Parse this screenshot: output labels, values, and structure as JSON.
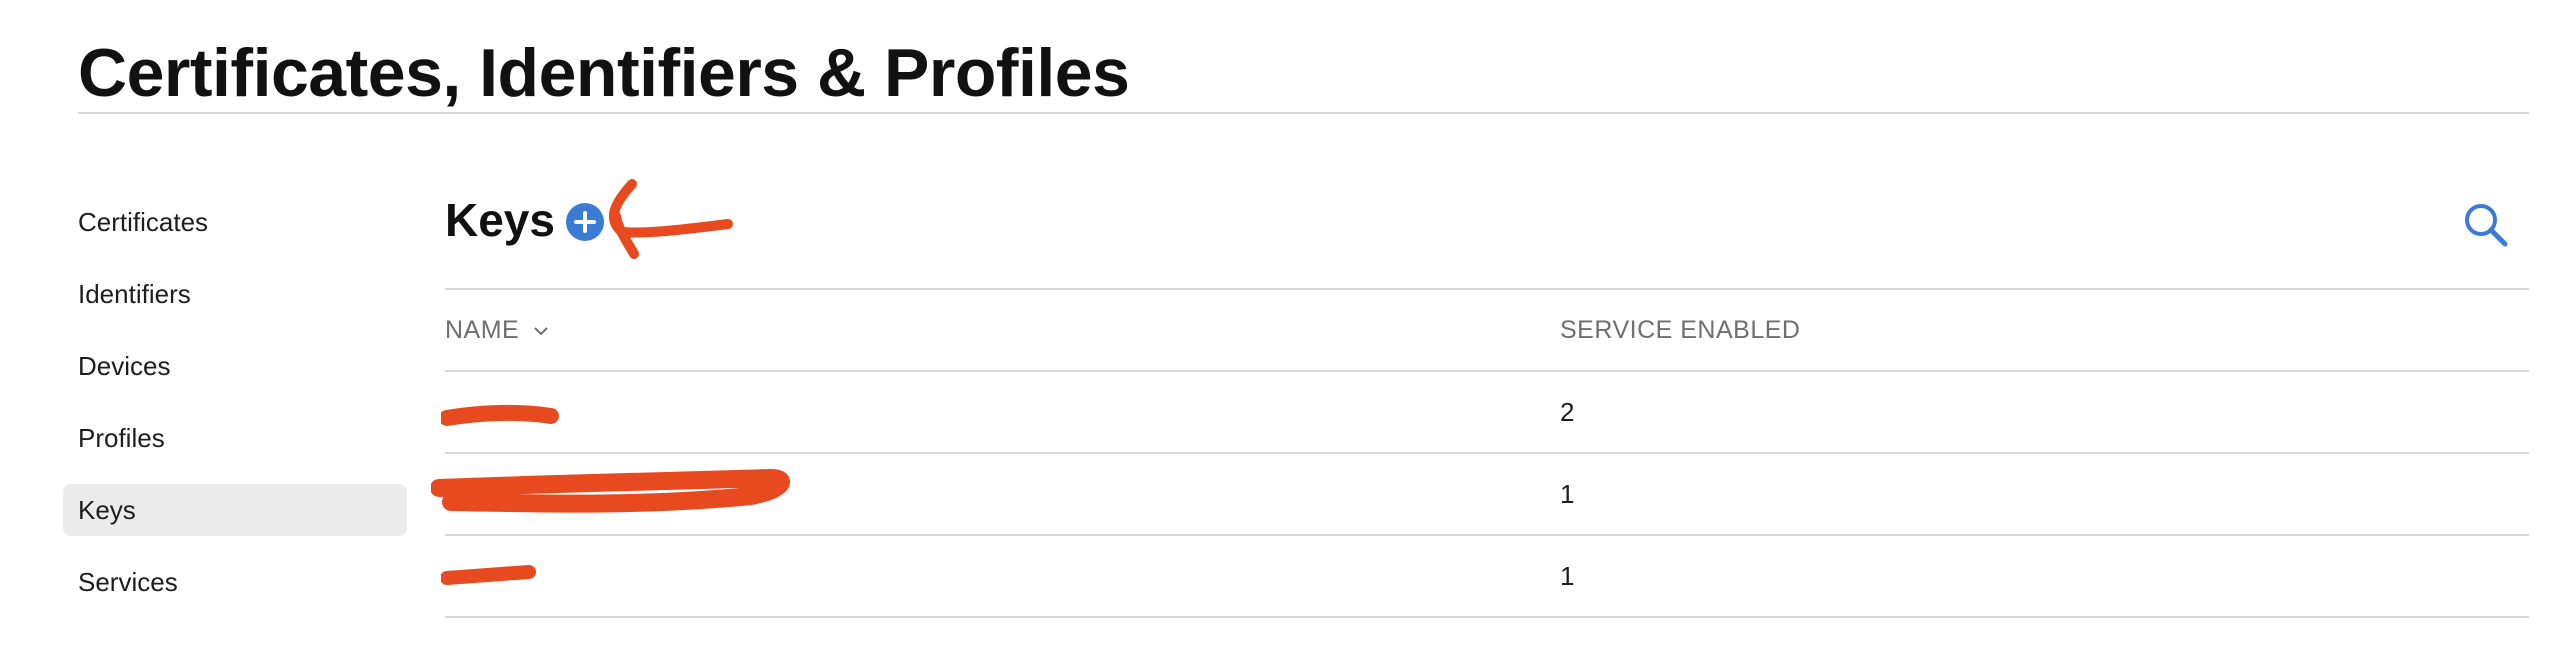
{
  "page": {
    "title": "Certificates, Identifiers & Profiles"
  },
  "sidebar": {
    "items": [
      {
        "label": "Certificates",
        "active": false
      },
      {
        "label": "Identifiers",
        "active": false
      },
      {
        "label": "Devices",
        "active": false
      },
      {
        "label": "Profiles",
        "active": false
      },
      {
        "label": "Keys",
        "active": true
      },
      {
        "label": "Services",
        "active": false
      }
    ]
  },
  "main": {
    "section_title": "Keys",
    "add_icon": "plus-circle-icon",
    "search_icon": "magnifier-icon",
    "accent_color": "#3a7bd5",
    "annotation_color": "#e84a1f"
  },
  "table": {
    "columns": {
      "name": "NAME",
      "service": "SERVICE ENABLED"
    },
    "sort_icon": "chevron-down-icon",
    "rows": [
      {
        "name": "",
        "service": "2"
      },
      {
        "name": "",
        "service": "1"
      },
      {
        "name": "",
        "service": "1"
      }
    ]
  }
}
